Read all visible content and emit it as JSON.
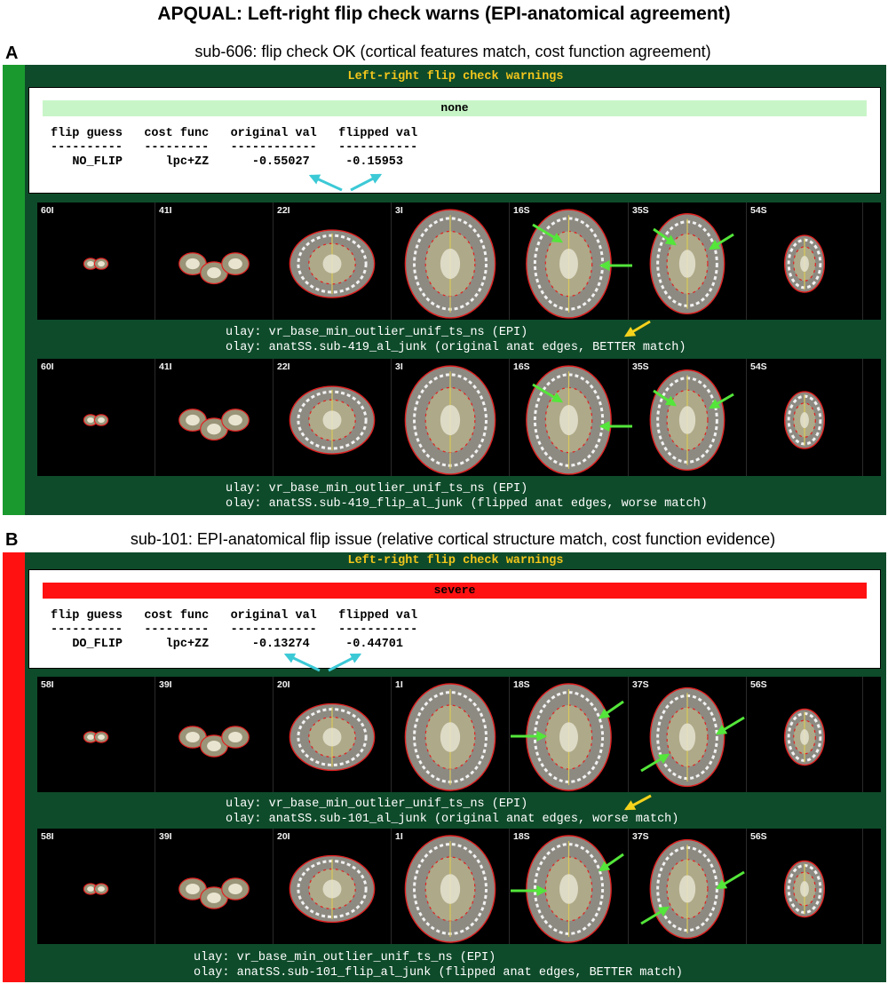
{
  "figure": {
    "title": "APQUAL:  Left-right flip check warns (EPI-anatomical agreement)"
  },
  "colors": {
    "frame": "#0e4b2a",
    "warn_title": "#f3c61c",
    "ok_bar": "#1a9a2e",
    "bad_bar": "#ff1111",
    "none_level": "#c8f5c8",
    "severe_level": "#ff1111",
    "green_arrow": "#54e63a",
    "cyan_arrow": "#3cc9d6",
    "yellow_arrow": "#f5d21c"
  },
  "panels": [
    {
      "letter": "A",
      "heading": "sub-606: flip check OK (cortical features match, cost function agreement)",
      "warn_title": "Left-right flip check warnings",
      "level": "none",
      "table_header": [
        "flip guess",
        "cost func",
        "original val",
        "flipped val"
      ],
      "table_dashes": [
        "----------",
        "---------",
        "------------",
        "-----------"
      ],
      "table_row": [
        "NO_FLIP",
        "lpc+ZZ",
        "-0.55027",
        "-0.15953"
      ],
      "strips": [
        {
          "slices": [
            "60I",
            "41I",
            "22I",
            "3I",
            "16S",
            "35S",
            "54S"
          ],
          "ulay": "ulay: vr_base_min_outlier_unif_ts_ns (EPI)",
          "olay": "olay: anatSS.sub-419_al_junk (original anat edges, BETTER match)"
        },
        {
          "slices": [
            "60I",
            "41I",
            "22I",
            "3I",
            "16S",
            "35S",
            "54S"
          ],
          "ulay": "ulay: vr_base_min_outlier_unif_ts_ns (EPI)",
          "olay": "olay: anatSS.sub-419_flip_al_junk (flipped anat edges, worse match)"
        }
      ]
    },
    {
      "letter": "B",
      "heading": "sub-101: EPI-anatomical flip issue (relative cortical structure match, cost function evidence)",
      "warn_title": "Left-right flip check warnings",
      "level": "severe",
      "table_header": [
        "flip guess",
        "cost func",
        "original val",
        "flipped val"
      ],
      "table_dashes": [
        "----------",
        "---------",
        "------------",
        "-----------"
      ],
      "table_row": [
        "DO_FLIP",
        "lpc+ZZ",
        "-0.13274",
        "-0.44701"
      ],
      "strips": [
        {
          "slices": [
            "58I",
            "39I",
            "20I",
            "1I",
            "18S",
            "37S",
            "56S"
          ],
          "ulay": "ulay: vr_base_min_outlier_unif_ts_ns (EPI)",
          "olay": "olay: anatSS.sub-101_al_junk (original anat edges, worse match)"
        },
        {
          "slices": [
            "58I",
            "39I",
            "20I",
            "1I",
            "18S",
            "37S",
            "56S"
          ],
          "ulay": "ulay: vr_base_min_outlier_unif_ts_ns (EPI)",
          "olay": "olay: anatSS.sub-101_flip_al_junk (flipped anat edges, BETTER match)"
        }
      ]
    }
  ]
}
